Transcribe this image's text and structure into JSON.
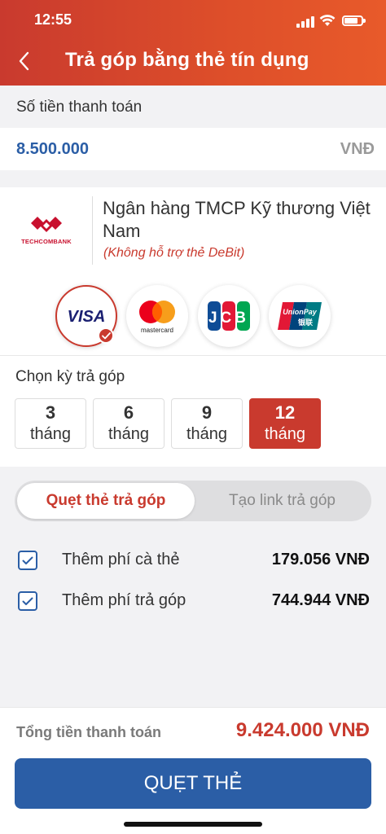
{
  "status_bar": {
    "time": "12:55"
  },
  "header": {
    "title": "Trả góp bằng thẻ tín dụng"
  },
  "payment": {
    "label": "Số tiền thanh toán",
    "amount": "8.500.000",
    "currency": "VNĐ"
  },
  "bank": {
    "logo_text": "TECHCOMBANK",
    "name": "Ngân hàng TMCP Kỹ thương Việt Nam",
    "note": "(Không hỗ trợ thẻ DeBit)",
    "brand_color": "#c8102e"
  },
  "card_brands": [
    {
      "name": "VISA",
      "selected": true
    },
    {
      "name": "mastercard",
      "selected": false
    },
    {
      "name": "JCB",
      "selected": false
    },
    {
      "name": "UnionPay",
      "sub": "银联",
      "selected": false
    }
  ],
  "term": {
    "label": "Chọn kỳ trả góp",
    "options": [
      {
        "n": "3",
        "unit": "tháng"
      },
      {
        "n": "6",
        "unit": "tháng"
      },
      {
        "n": "9",
        "unit": "tháng"
      },
      {
        "n": "12",
        "unit": "tháng"
      }
    ],
    "selected": "12"
  },
  "mode_tabs": [
    {
      "label": "Quẹt thẻ trả góp",
      "active": true
    },
    {
      "label": "Tạo link trả góp",
      "active": false
    }
  ],
  "fees": [
    {
      "label": "Thêm phí cà thẻ",
      "value": "179.056 VNĐ",
      "checked": true
    },
    {
      "label": "Thêm phí trả góp",
      "value": "744.944 VNĐ",
      "checked": true
    }
  ],
  "total": {
    "label": "Tổng tiền thanh toán",
    "value": "9.424.000 VNĐ"
  },
  "primary_button": {
    "label": "QUẸT THẺ"
  },
  "colors": {
    "accent_red": "#c93a2e",
    "primary_blue": "#2b5ea6"
  }
}
